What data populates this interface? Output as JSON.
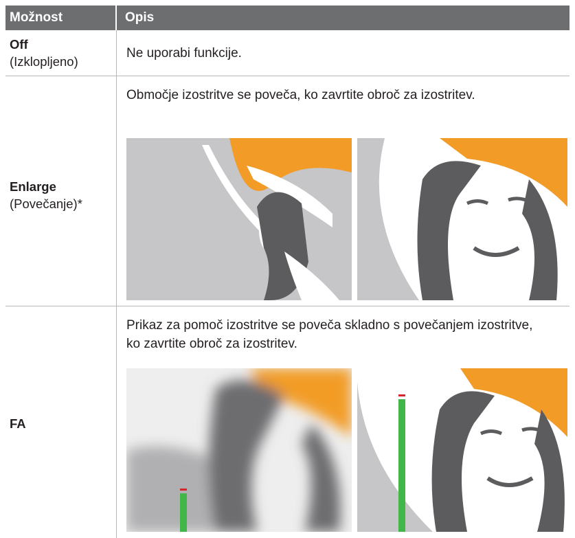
{
  "header": {
    "col1": "Možnost",
    "col2": "Opis"
  },
  "rows": [
    {
      "name": "Off",
      "sub": "(Izklopljeno)",
      "desc": "Ne uporabi funkcije."
    },
    {
      "name": "Enlarge",
      "sub": "(Povečanje)*",
      "desc": "Območje izostritve se poveča, ko zavrtite obroč za izostritev."
    },
    {
      "name": "FA",
      "sub": "",
      "desc": "Prikaz za pomoč izostritve se poveča skladno s povečanjem izostritve, ko zavrtite obroč za izostritev."
    }
  ],
  "colors": {
    "header_bg": "#6d6e70",
    "umbrella": "#f29c27",
    "figure": "#5c5c5e",
    "bg_grey": "#c6c6c8",
    "meter_green": "#42b649",
    "meter_red": "#d7262b"
  },
  "fa_meter_levels": {
    "blurred": 0.27,
    "sharp": 0.83
  }
}
